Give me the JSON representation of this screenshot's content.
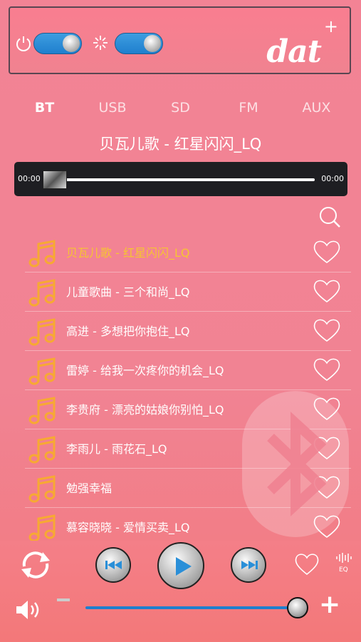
{
  "header": {
    "brand": "dat",
    "add_label": "+"
  },
  "tabs": [
    {
      "label": "BT",
      "active": true
    },
    {
      "label": "USB"
    },
    {
      "label": "SD"
    },
    {
      "label": "FM"
    },
    {
      "label": "AUX"
    }
  ],
  "now_playing": {
    "title": "贝瓦儿歌 - 红星闪闪_LQ",
    "elapsed": "00:00",
    "duration": "00:00",
    "progress_fraction": 0.0
  },
  "playlist": [
    {
      "title": "贝瓦儿歌 - 红星闪闪_LQ",
      "active": true
    },
    {
      "title": "儿童歌曲 - 三个和尚_LQ"
    },
    {
      "title": "高进 - 多想把你抱住_LQ"
    },
    {
      "title": "雷婷 - 给我一次疼你的机会_LQ"
    },
    {
      "title": "李贵府 - 漂亮的姑娘你别怕_LQ"
    },
    {
      "title": "李雨儿 - 雨花石_LQ"
    },
    {
      "title": "勉强幸福"
    },
    {
      "title": "慕容晓晓 - 爱情买卖_LQ"
    }
  ],
  "controls": {
    "eq_label": "EQ",
    "volume_fraction": 0.98,
    "vol_plus": "+"
  },
  "colors": {
    "accent_active": "#f6c531",
    "note_icon": "#f7a933",
    "toggle_blue": "#1f7fce",
    "bg": "#f38395"
  }
}
